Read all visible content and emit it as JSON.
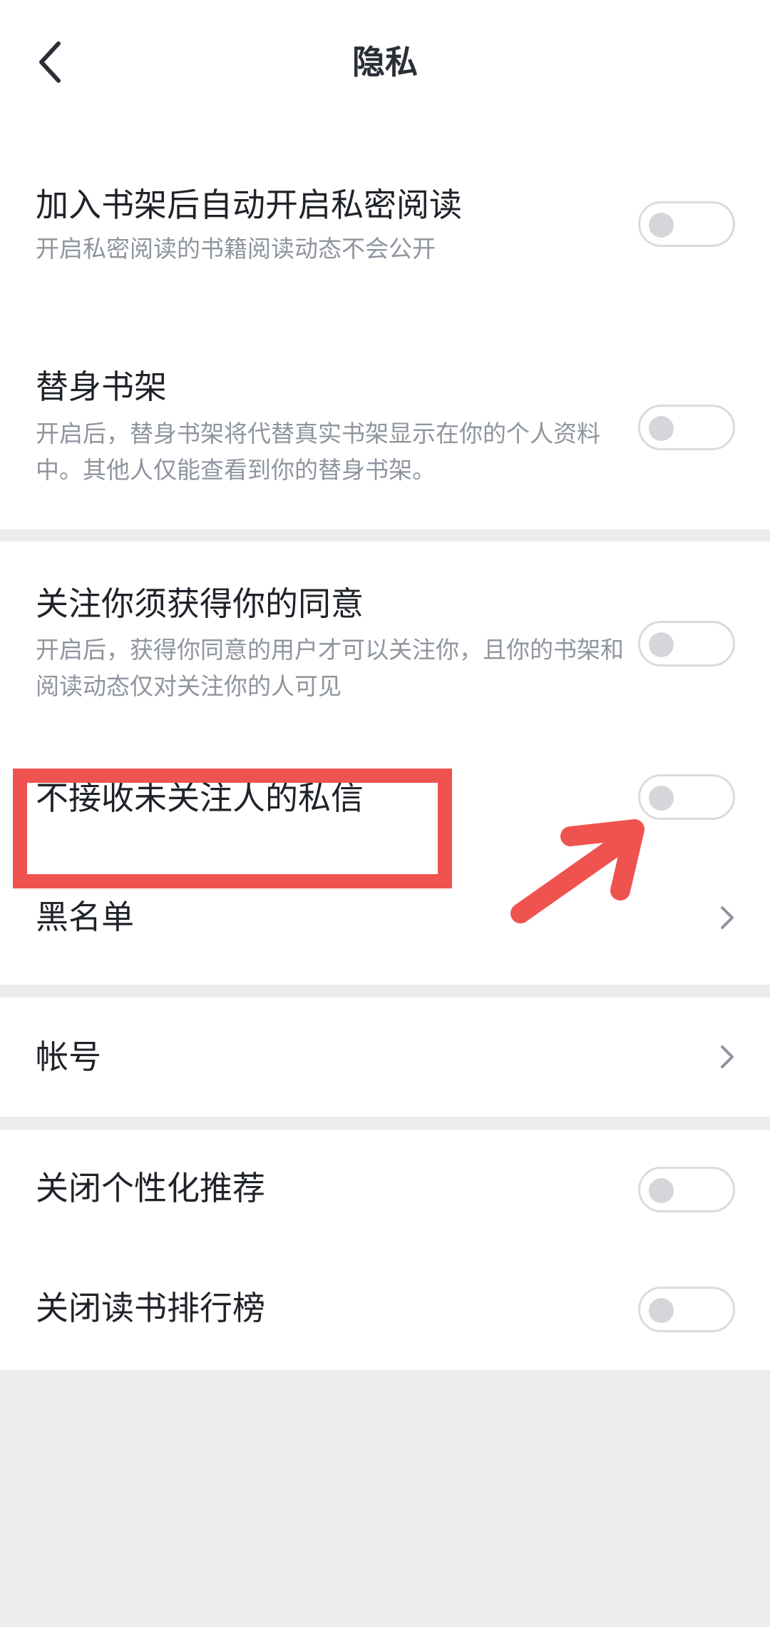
{
  "header": {
    "back_icon": "chevron-left-icon",
    "title": "隐私"
  },
  "rows": {
    "auto_private": {
      "title": "加入书架后自动开启私密阅读",
      "desc": "开启私密阅读的书籍阅读动态不会公开",
      "enabled": false
    },
    "alias_shelf": {
      "title": "替身书架",
      "desc": "开启后，替身书架将代替真实书架显示在你的个人资料中。其他人仅能查看到你的替身书架。",
      "enabled": false
    },
    "follow_consent": {
      "title": "关注你须获得你的同意",
      "desc": "开启后，获得你同意的用户才可以关注你，且你的书架和阅读动态仅对关注你的人可见",
      "enabled": false
    },
    "block_dm": {
      "title": "不接收未关注人的私信",
      "enabled": false
    },
    "blacklist": {
      "title": "黑名单",
      "icon": "chevron-right-icon"
    },
    "account": {
      "title": "帐号",
      "icon": "chevron-right-icon"
    },
    "personalized": {
      "title": "关闭个性化推荐",
      "enabled": false
    },
    "ranking": {
      "title": "关闭读书排行榜",
      "enabled": false
    }
  },
  "colors": {
    "annotation": "#ef5350",
    "toggle_off_border": "#d9dbdf",
    "toggle_knob": "#d5d6d9",
    "background": "#ebecee"
  }
}
